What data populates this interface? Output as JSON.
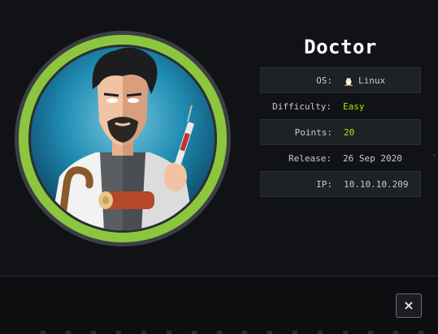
{
  "machine": {
    "name": "Doctor",
    "info": [
      {
        "key": "OS:",
        "value": "Linux",
        "icon": "linux-tux-icon",
        "style": "normal"
      },
      {
        "key": "Difficulty:",
        "value": "Easy",
        "style": "green"
      },
      {
        "key": "Points:",
        "value": "20",
        "style": "green"
      },
      {
        "key": "Release:",
        "value": "26 Sep 2020",
        "style": "normal"
      },
      {
        "key": "IP:",
        "value": "10.10.10.209",
        "style": "normal"
      }
    ]
  },
  "dialog": {
    "close_label": "×"
  },
  "colors": {
    "accent_green": "#9fef00",
    "ring_green": "#8cc63f",
    "background": "#111215"
  }
}
